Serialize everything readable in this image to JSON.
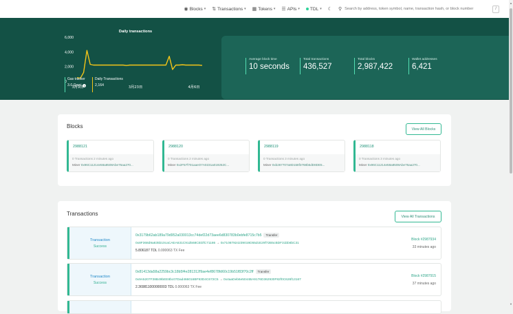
{
  "nav": {
    "blocks": "Blocks",
    "transactions": "Transactions",
    "tokens": "Tokens",
    "apis": "APIs",
    "network": "TDL",
    "search_placeholder": "Search by address, token symbol, name, transaction hash, or block number",
    "shortcut": "/"
  },
  "chart_data": {
    "type": "line",
    "title": "Daily transactions",
    "x_labels": [
      "3月9日",
      "3月23日",
      "4月6日"
    ],
    "y_ticks": [
      "6,000",
      "4,000",
      "2,000",
      "0"
    ],
    "ylim": [
      0,
      6000
    ],
    "series": [
      {
        "values": [
          500,
          400,
          1200,
          4200,
          2300,
          2200,
          2200,
          2200,
          2200,
          2200,
          2200,
          2200,
          2200,
          2200,
          2200,
          2150,
          2200,
          2200,
          2200,
          2200,
          2200,
          2200,
          2200,
          2200,
          2200,
          2200,
          2200,
          2200,
          3400,
          1600,
          2200,
          2200,
          2250,
          2200,
          2200,
          2200,
          2200,
          2200,
          2164
        ],
        "color": "#f5c518"
      }
    ],
    "grid": false
  },
  "hero_mini": {
    "gas_label": "Gas tracker",
    "gas_value": "3.0 Gwei",
    "daily_label": "Daily Transactions",
    "daily_value": "2,164"
  },
  "stats": [
    {
      "label": "Average block time",
      "value": "10 seconds"
    },
    {
      "label": "Total transactions",
      "value": "436,527"
    },
    {
      "label": "Total blocks",
      "value": "2,987,422"
    },
    {
      "label": "Wallet addresses",
      "value": "6,421"
    }
  ],
  "blocks": {
    "title": "Blocks",
    "view_all": "View All Blocks",
    "items": [
      {
        "number": "2988121",
        "meta": "0 Transactions   2 minutes ago",
        "miner_label": "Miner",
        "miner": "0x96C11214e58a8508Abe76aa270..."
      },
      {
        "number": "2988120",
        "meta": "0 Transactions   2 minutes ago",
        "miner_label": "Miner",
        "miner": "0x2F57f701aaeO7A0231a019252C..."
      },
      {
        "number": "2988119",
        "meta": "0 Transactions   3 minutes ago",
        "miner_label": "Miner",
        "miner": "0xb267707a8D158f3768b5dD8DE5..."
      },
      {
        "number": "2988118",
        "meta": "0 Transactions   3 minutes ago",
        "miner_label": "Miner",
        "miner": "0x96C11214e58a8508Abe76aa270..."
      }
    ]
  },
  "transactions": {
    "title": "Transactions",
    "view_all": "View All Transactions",
    "items": [
      {
        "type": "Transaction",
        "status": "Success",
        "hash": "0x3179b62ab189a79d952a030013cc74def22d73aee6d830783b0ebfe8715c7b5",
        "badge": "Transfer",
        "from": "0x8F368d9a835b10caCAEA631C91d568CEDfC71186",
        "to": "0x71087924239019D55dcE29f72B5cBDF31bb6bC31",
        "amount": "5.806187 TDL",
        "fee": "0.000063 TX Fee",
        "block": "Block #2987934",
        "time": "33 minutes ago"
      },
      {
        "type": "Transaction",
        "status": "Success",
        "hash": "0x81413da58a2259bc3c18b5f4e281312f9ae4ef8678fd60c19b51f83f70c2ff",
        "badge": "Transfer",
        "from": "0x9A5207F38B49bEE8bc07Dad466016BF93D4C672C5",
        "to": "0x4aaDeb6e5044BA9176D362930F82f0C626f13167",
        "amount": "2.369811000000003 TDL",
        "fee": "0.000063 TX Fee",
        "block": "Block #2987915",
        "time": "37 minutes ago"
      }
    ]
  }
}
